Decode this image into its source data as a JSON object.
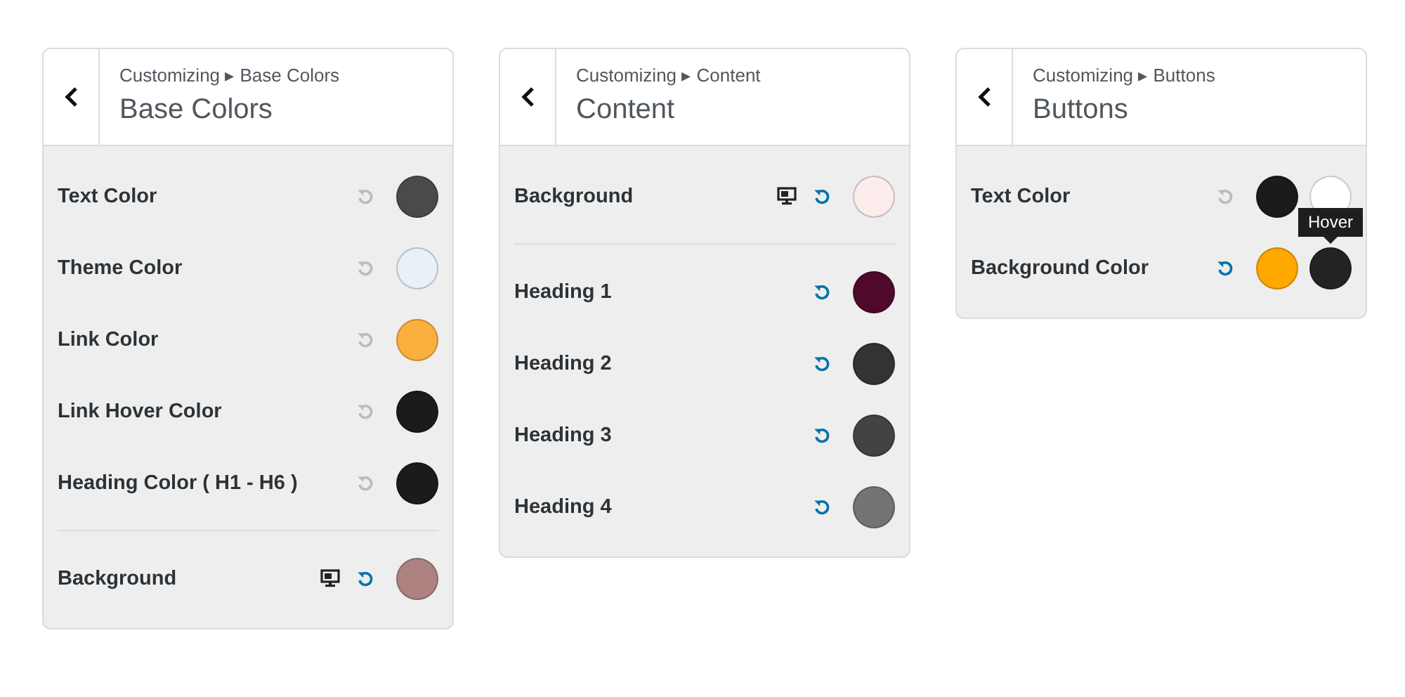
{
  "panels": [
    {
      "breadcrumb": "Customizing ▸ Base Colors",
      "title": "Base Colors",
      "rows": [
        {
          "label": "Text Color",
          "divider_before": false,
          "responsive": false,
          "modified": false,
          "swatches": [
            {
              "color": "#4a4a4a"
            }
          ]
        },
        {
          "label": "Theme Color",
          "divider_before": false,
          "responsive": false,
          "modified": false,
          "swatches": [
            {
              "color": "#e8f0f8"
            }
          ]
        },
        {
          "label": "Link Color",
          "divider_before": false,
          "responsive": false,
          "modified": false,
          "swatches": [
            {
              "color": "#fbaf3e"
            }
          ]
        },
        {
          "label": "Link Hover Color",
          "divider_before": false,
          "responsive": false,
          "modified": false,
          "swatches": [
            {
              "color": "#1b1b1b"
            }
          ]
        },
        {
          "label": "Heading Color ( H1 - H6 )",
          "divider_before": false,
          "responsive": false,
          "modified": false,
          "swatches": [
            {
              "color": "#1b1b1b"
            }
          ]
        },
        {
          "label": "Background",
          "divider_before": true,
          "responsive": true,
          "modified": true,
          "swatches": [
            {
              "color": "#ad8281"
            }
          ]
        }
      ]
    },
    {
      "breadcrumb": "Customizing ▸ Content",
      "title": "Content",
      "rows": [
        {
          "label": "Background",
          "divider_before": false,
          "responsive": true,
          "modified": true,
          "swatches": [
            {
              "color": "#fcecec"
            }
          ]
        },
        {
          "label": "Heading 1",
          "divider_before": true,
          "responsive": false,
          "modified": true,
          "swatches": [
            {
              "color": "#4f0a2b"
            }
          ]
        },
        {
          "label": "Heading 2",
          "divider_before": false,
          "responsive": false,
          "modified": true,
          "swatches": [
            {
              "color": "#333333"
            }
          ]
        },
        {
          "label": "Heading 3",
          "divider_before": false,
          "responsive": false,
          "modified": true,
          "swatches": [
            {
              "color": "#434343"
            }
          ]
        },
        {
          "label": "Heading 4",
          "divider_before": false,
          "responsive": false,
          "modified": true,
          "swatches": [
            {
              "color": "#747474"
            }
          ]
        }
      ]
    },
    {
      "breadcrumb": "Customizing ▸ Buttons",
      "title": "Buttons",
      "rows": [
        {
          "label": "Text Color",
          "divider_before": false,
          "responsive": false,
          "modified": false,
          "swatches": [
            {
              "color": "#1b1b1b"
            },
            {
              "color": "#ffffff"
            }
          ]
        },
        {
          "label": "Background Color",
          "divider_before": false,
          "responsive": false,
          "modified": true,
          "swatches": [
            {
              "color": "#ffa800"
            },
            {
              "color": "#232323",
              "tooltip": "Hover"
            }
          ]
        }
      ]
    }
  ]
}
